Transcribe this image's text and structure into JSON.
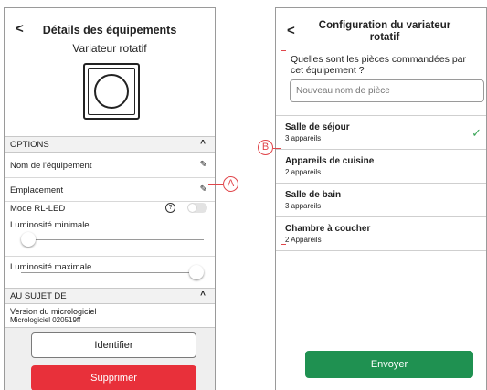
{
  "left_screen": {
    "back_icon": "chevron-left-icon",
    "title": "Détails des équipements",
    "device_subtitle": "Variateur rotatif",
    "options_header": "OPTIONS",
    "options": {
      "name": "Nom de l'équipement",
      "location": "Emplacement",
      "rl_led_mode": "Mode RL-LED",
      "help_glyph": "?",
      "min_brightness": "Luminosité minimale",
      "max_brightness": "Luminosité maximale"
    },
    "rl_led_enabled": false,
    "min_brightness_level": 0.04,
    "max_brightness_level": 0.96,
    "about_header": "AU SUJET DE",
    "firmware_label": "Version du micrologiciel",
    "firmware_value": "Micrologiciel 020519ff",
    "identify_button": "Identifier",
    "delete_button": "Supprimer"
  },
  "right_screen": {
    "back_icon": "chevron-left-icon",
    "title_line1": "Configuration du variateur",
    "title_line2": "rotatif",
    "question": "Quelles sont les pièces commandées par cet équipement ?",
    "new_room_placeholder": "Nouveau nom de pièce",
    "rooms": [
      {
        "name": "Salle de séjour",
        "count": "3 appareils",
        "selected": true
      },
      {
        "name": "Appareils de cuisine",
        "count": "2 appareils",
        "selected": false
      },
      {
        "name": "Salle de bain",
        "count": "3 appareils",
        "selected": false
      },
      {
        "name": "Chambre à coucher",
        "count": "2 Appareils",
        "selected": false
      }
    ],
    "send_button": "Envoyer"
  },
  "callouts": {
    "a": "A",
    "b": "B"
  },
  "colors": {
    "delete_red": "#e8303a",
    "send_green": "#1f9151",
    "callout_red": "#e0464b",
    "check_green": "#3aa558"
  }
}
